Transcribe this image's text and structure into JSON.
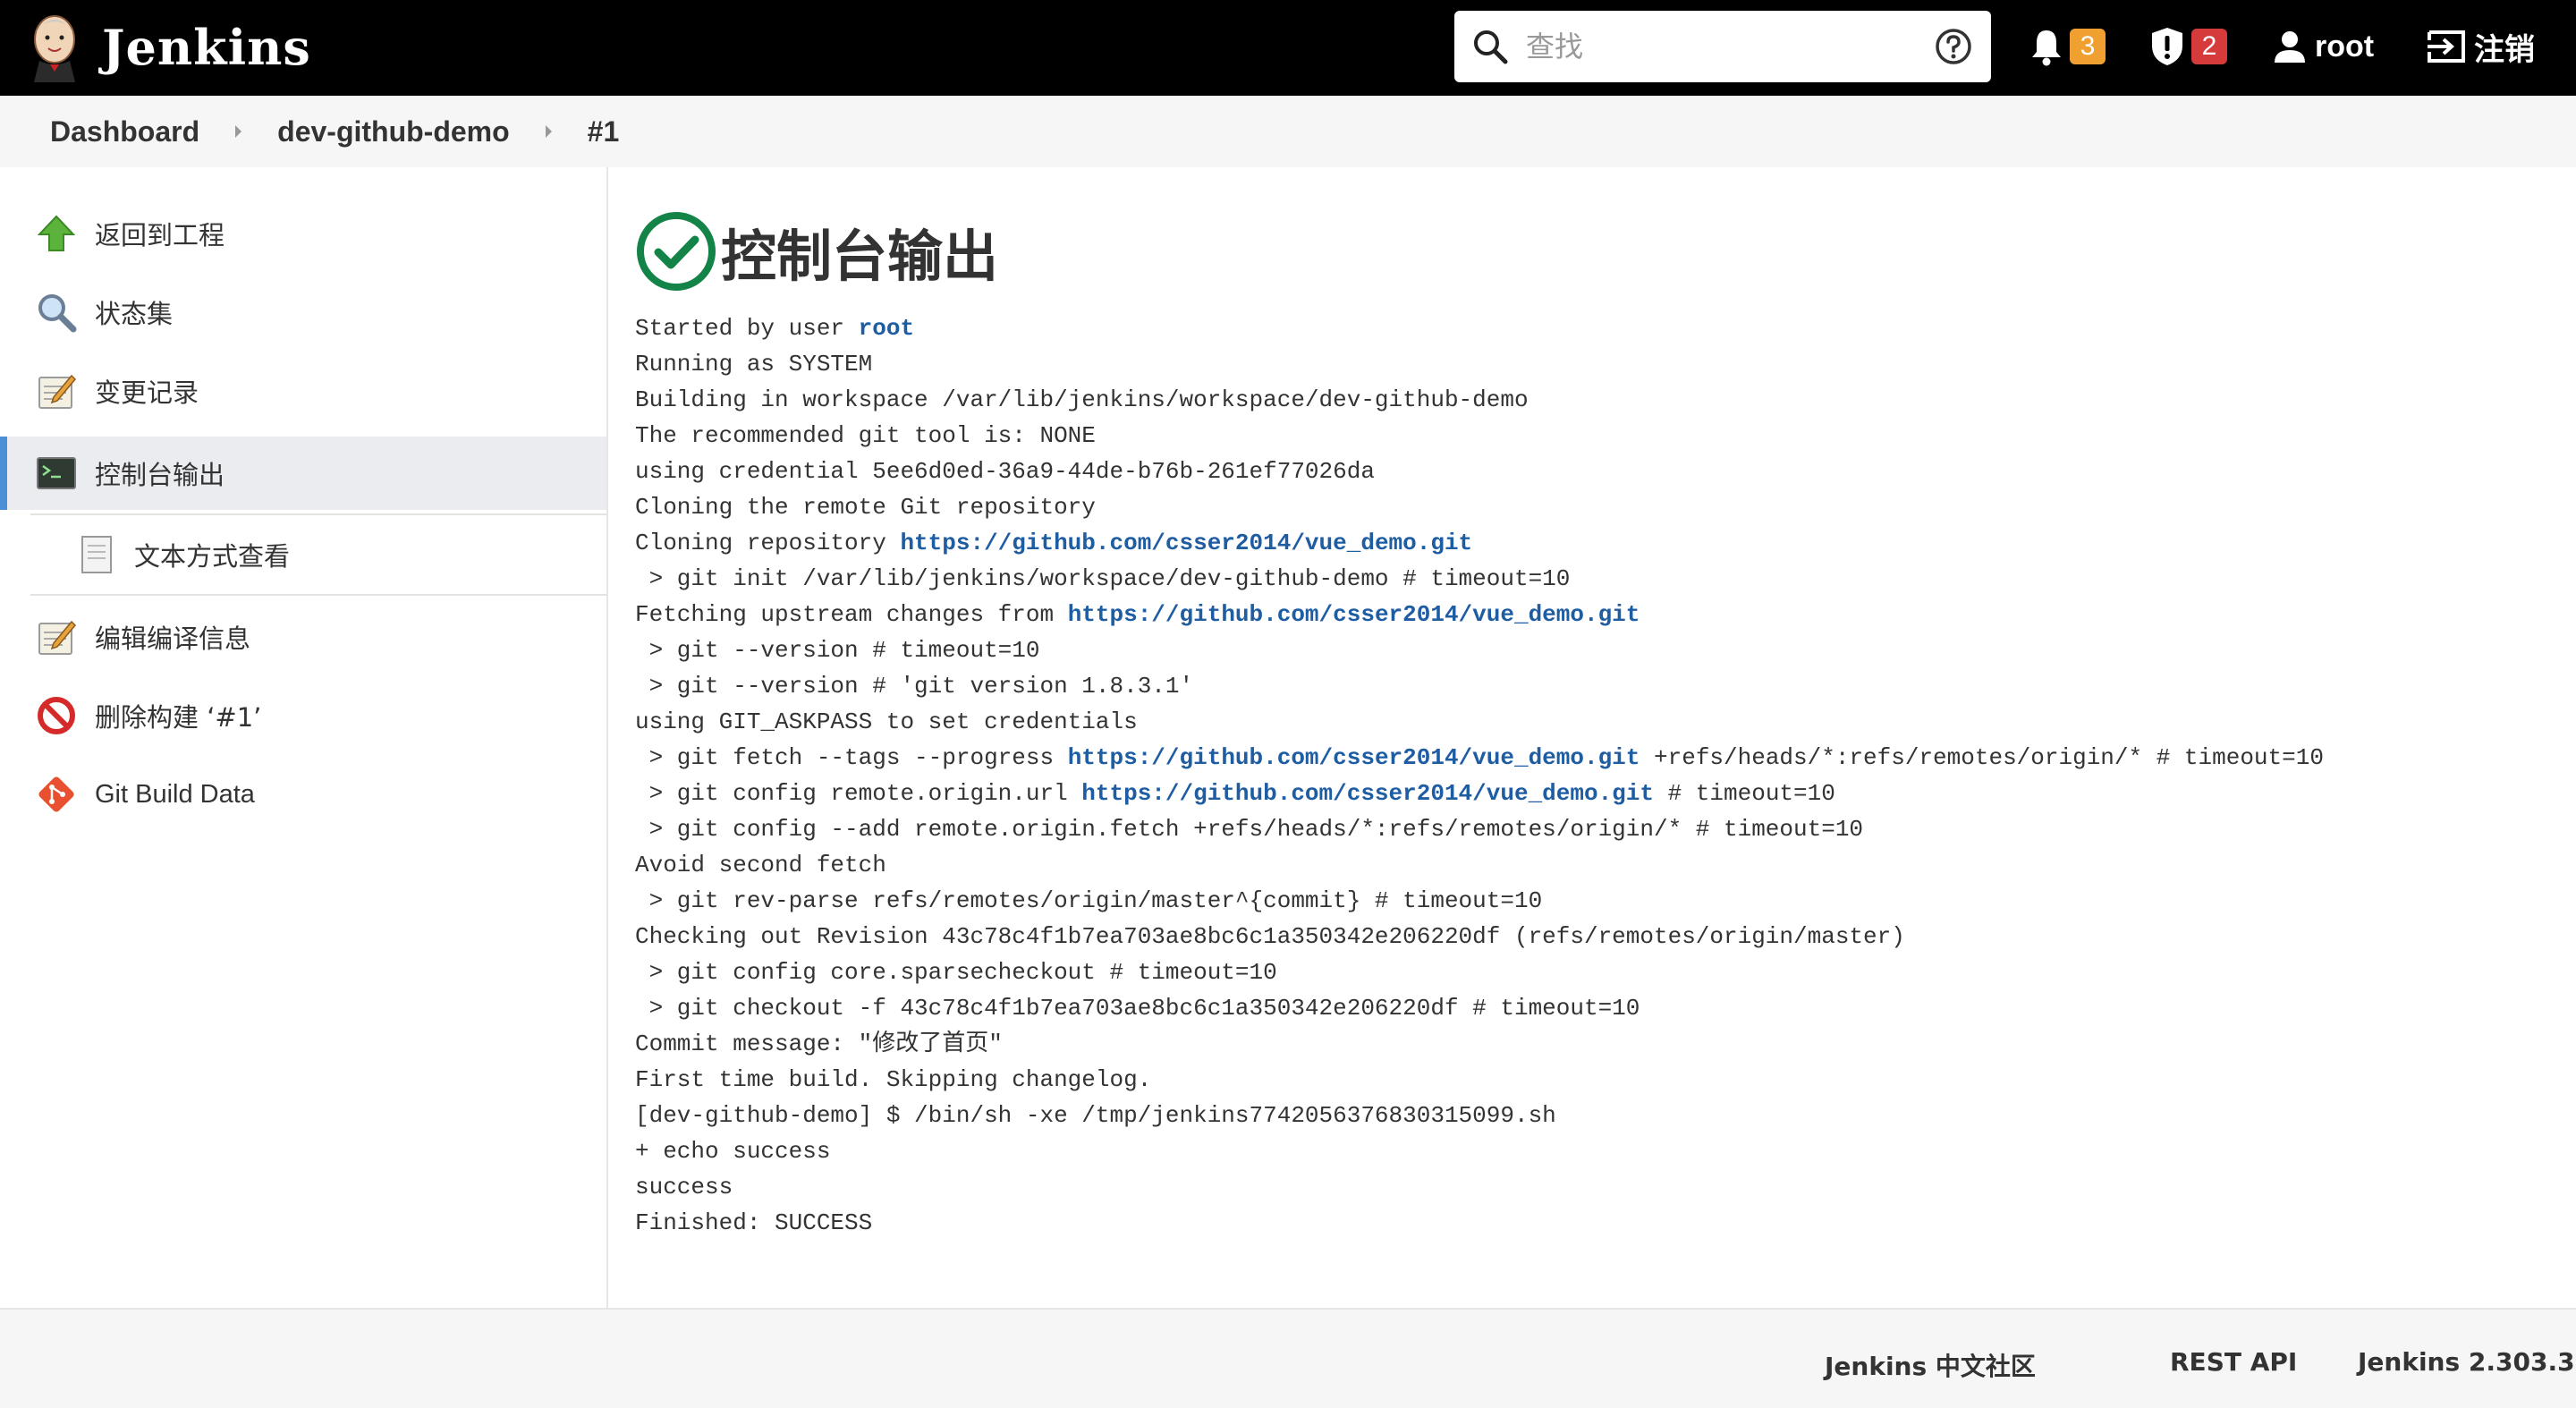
{
  "header": {
    "app_name": "Jenkins",
    "search_placeholder": "查找",
    "notifications_count": "3",
    "security_count": "2",
    "user": "root",
    "logout_label": "注销"
  },
  "breadcrumb": [
    "Dashboard",
    "dev-github-demo",
    "#1"
  ],
  "sidebar": {
    "items": [
      {
        "label": "返回到工程",
        "icon": "up-arrow-icon"
      },
      {
        "label": "状态集",
        "icon": "magnifier-icon"
      },
      {
        "label": "变更记录",
        "icon": "notepad-icon"
      },
      {
        "label": "控制台输出",
        "icon": "terminal-icon",
        "active": true
      },
      {
        "label": "文本方式查看",
        "icon": "document-icon",
        "sub": true
      },
      {
        "label": "编辑编译信息",
        "icon": "notepad-icon"
      },
      {
        "label": "删除构建 ‘#1’",
        "icon": "no-entry-icon"
      },
      {
        "label": "Git Build Data",
        "icon": "git-icon"
      }
    ]
  },
  "main": {
    "title": "控制台输出",
    "status": "success",
    "colors": {
      "success": "#138347",
      "link": "#1f5da3",
      "accent": "#4b8fd6"
    },
    "console_lines": [
      [
        {
          "t": "Started by user "
        },
        {
          "t": "root",
          "link": true
        }
      ],
      [
        {
          "t": "Running as SYSTEM"
        }
      ],
      [
        {
          "t": "Building in workspace /var/lib/jenkins/workspace/dev-github-demo"
        }
      ],
      [
        {
          "t": "The recommended git tool is: NONE"
        }
      ],
      [
        {
          "t": "using credential 5ee6d0ed-36a9-44de-b76b-261ef77026da"
        }
      ],
      [
        {
          "t": "Cloning the remote Git repository"
        }
      ],
      [
        {
          "t": "Cloning repository "
        },
        {
          "t": "https://github.com/csser2014/vue_demo.git",
          "link": true
        }
      ],
      [
        {
          "t": " > git init /var/lib/jenkins/workspace/dev-github-demo # timeout=10"
        }
      ],
      [
        {
          "t": "Fetching upstream changes from "
        },
        {
          "t": "https://github.com/csser2014/vue_demo.git",
          "link": true
        }
      ],
      [
        {
          "t": " > git --version # timeout=10"
        }
      ],
      [
        {
          "t": " > git --version # 'git version 1.8.3.1'"
        }
      ],
      [
        {
          "t": "using GIT_ASKPASS to set credentials"
        }
      ],
      [
        {
          "t": " > git fetch --tags --progress "
        },
        {
          "t": "https://github.com/csser2014/vue_demo.git",
          "link": true
        },
        {
          "t": " +refs/heads/*:refs/remotes/origin/* # timeout=10"
        }
      ],
      [
        {
          "t": " > git config remote.origin.url "
        },
        {
          "t": "https://github.com/csser2014/vue_demo.git",
          "link": true
        },
        {
          "t": " # timeout=10"
        }
      ],
      [
        {
          "t": " > git config --add remote.origin.fetch +refs/heads/*:refs/remotes/origin/* # timeout=10"
        }
      ],
      [
        {
          "t": "Avoid second fetch"
        }
      ],
      [
        {
          "t": " > git rev-parse refs/remotes/origin/master^{commit} # timeout=10"
        }
      ],
      [
        {
          "t": "Checking out Revision 43c78c4f1b7ea703ae8bc6c1a350342e206220df (refs/remotes/origin/master)"
        }
      ],
      [
        {
          "t": " > git config core.sparsecheckout # timeout=10"
        }
      ],
      [
        {
          "t": " > git checkout -f 43c78c4f1b7ea703ae8bc6c1a350342e206220df # timeout=10"
        }
      ],
      [
        {
          "t": "Commit message: \"修改了首页\""
        }
      ],
      [
        {
          "t": "First time build. Skipping changelog."
        }
      ],
      [
        {
          "t": "[dev-github-demo] $ /bin/sh -xe /tmp/jenkins7742056376830315099.sh"
        }
      ],
      [
        {
          "t": "+ echo success"
        }
      ],
      [
        {
          "t": "success"
        }
      ],
      [
        {
          "t": "Finished: SUCCESS"
        }
      ]
    ]
  },
  "footer": {
    "community": "Jenkins 中文社区",
    "rest_api": "REST API",
    "version": "Jenkins 2.303.3"
  }
}
